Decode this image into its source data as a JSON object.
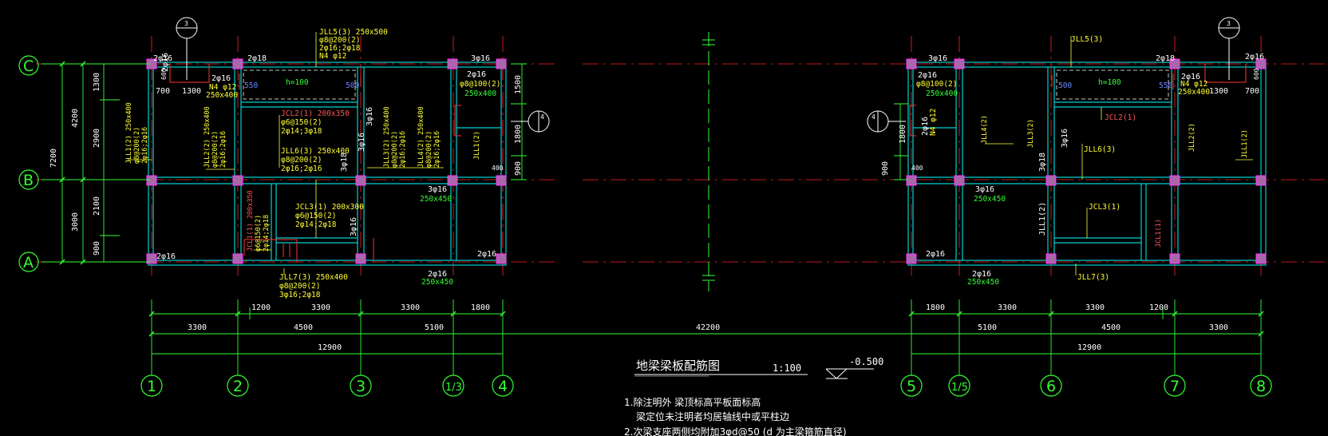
{
  "drawing": {
    "title": "地梁梁板配筋图",
    "scale": "1:100",
    "elevation": "-0.500",
    "notes": [
      "1.除注明外 梁顶标高平板面标高",
      "梁定位未注明者均居轴线中或平柱边",
      "2.次梁支座两侧均附加3φd@50 (d 为主梁箍筋直径)"
    ]
  },
  "axes_rows": [
    "C",
    "B",
    "A"
  ],
  "axes_cols_left": [
    "1",
    "2",
    "3",
    "1/3",
    "4"
  ],
  "axes_cols_right": [
    "5",
    "1/5",
    "6",
    "7",
    "8"
  ],
  "section_marks": {
    "left_top": "3",
    "right_top": "3",
    "left_side": "4",
    "right_side": "4"
  },
  "dims_left": {
    "vertical_outer": "7200",
    "vertical_mid": [
      "4200",
      "3000"
    ],
    "vertical_inner": [
      "1300",
      "2900",
      "2100",
      "900"
    ],
    "right_side": [
      "1500",
      "1800",
      "900"
    ],
    "bottom_row1": [
      "1200",
      "3300",
      "3300",
      "1800"
    ],
    "bottom_row2": [
      "3300",
      "4500",
      "5100"
    ],
    "bottom_total": "12900",
    "top_local": [
      "700",
      "1300"
    ],
    "small": [
      "550",
      "500",
      "600",
      "400",
      "600"
    ]
  },
  "dims_right": {
    "left_side": [
      "1800",
      "900"
    ],
    "bottom_row1": [
      "1800",
      "3300",
      "3300",
      "1200"
    ],
    "bottom_row2": [
      "5100",
      "4500",
      "3300"
    ],
    "bottom_total": "12900",
    "top_local": [
      "1300",
      "700"
    ],
    "small": [
      "500",
      "550",
      "600",
      "400",
      "600"
    ]
  },
  "overall_dim": "42200",
  "left_labels": {
    "jll5": [
      "JLL5(3) 250x500",
      "φ8@200(2)",
      "2φ16;2φ18",
      "N4 φ12"
    ],
    "top_bars": [
      "2φ16",
      "2φ18",
      "3φ16",
      "2φ16",
      "2φ16"
    ],
    "beam_c1": [
      "N4 φ12",
      "250x400"
    ],
    "jcl2": [
      "JCL2(1) 200x350",
      "φ6@150(2)",
      "2φ14;3φ18"
    ],
    "jll6": [
      "JLL6(3) 250x400",
      "φ8@200(2)",
      "2φ16;2φ16"
    ],
    "jll1": [
      "JLL1(2) 250x400",
      "φ8@200(2)",
      "2φ16;2φ16"
    ],
    "jll2": [
      "JLL2(2) 250x400",
      "φ8@200(2)",
      "2φ16;2φ16"
    ],
    "jll3": [
      "JLL3(2) 250x400",
      "φ8@200(2)",
      "2φ16;2φ16"
    ],
    "jll4": [
      "JLL4(2) 250x400",
      "φ8@200(2)",
      "2φ16;2φ16"
    ],
    "jcl3": [
      "JCL3(1) 200x300",
      "φ6@150(2)",
      "2φ14;2φ18"
    ],
    "jcl1": [
      "JCL1(1) 200x350",
      "φ6@150(2)",
      "2φ14;2φ18"
    ],
    "jll7": [
      "JLL7(3) 250x400",
      "φ8@200(2)",
      "3φ16;2φ18"
    ],
    "beam_1_3": [
      "φ8@100(2)",
      "250x400"
    ],
    "h": "h=100",
    "misc": [
      "3φ18",
      "3φ16",
      "3φ16",
      "3φ16",
      "250x450",
      "2φ16",
      "2φ16",
      "250x450",
      "2φ16",
      "2φ16",
      "3φ16",
      "JLL1(2)"
    ]
  },
  "right_labels": {
    "jll5": "JLL5(3)",
    "jll4": "JLL4(2)",
    "jll3": "JLL3(2)",
    "jll6": "JLL6(3)",
    "jcl2": "JCL2(1)",
    "jll2": "JLL2(2)",
    "jll1": "JLL1(2)",
    "jcl3": "JCL3(1)",
    "jcl1": "JCL1(1)",
    "jll7": "JLL7(3)",
    "beam_left": [
      "2φ16",
      "φ8@100(2)",
      "250x400"
    ],
    "beam_c8": [
      "N4 φ12",
      "250x400"
    ],
    "h": "h=100",
    "misc": [
      "3φ16",
      "2φ18",
      "2φ16",
      "2φ16",
      "3φ16",
      "250x450",
      "3φ18",
      "3φ16",
      "2φ16",
      "2φ16",
      "250x450",
      "2φ16",
      "N4 φ12",
      "JLL1(2)"
    ]
  }
}
